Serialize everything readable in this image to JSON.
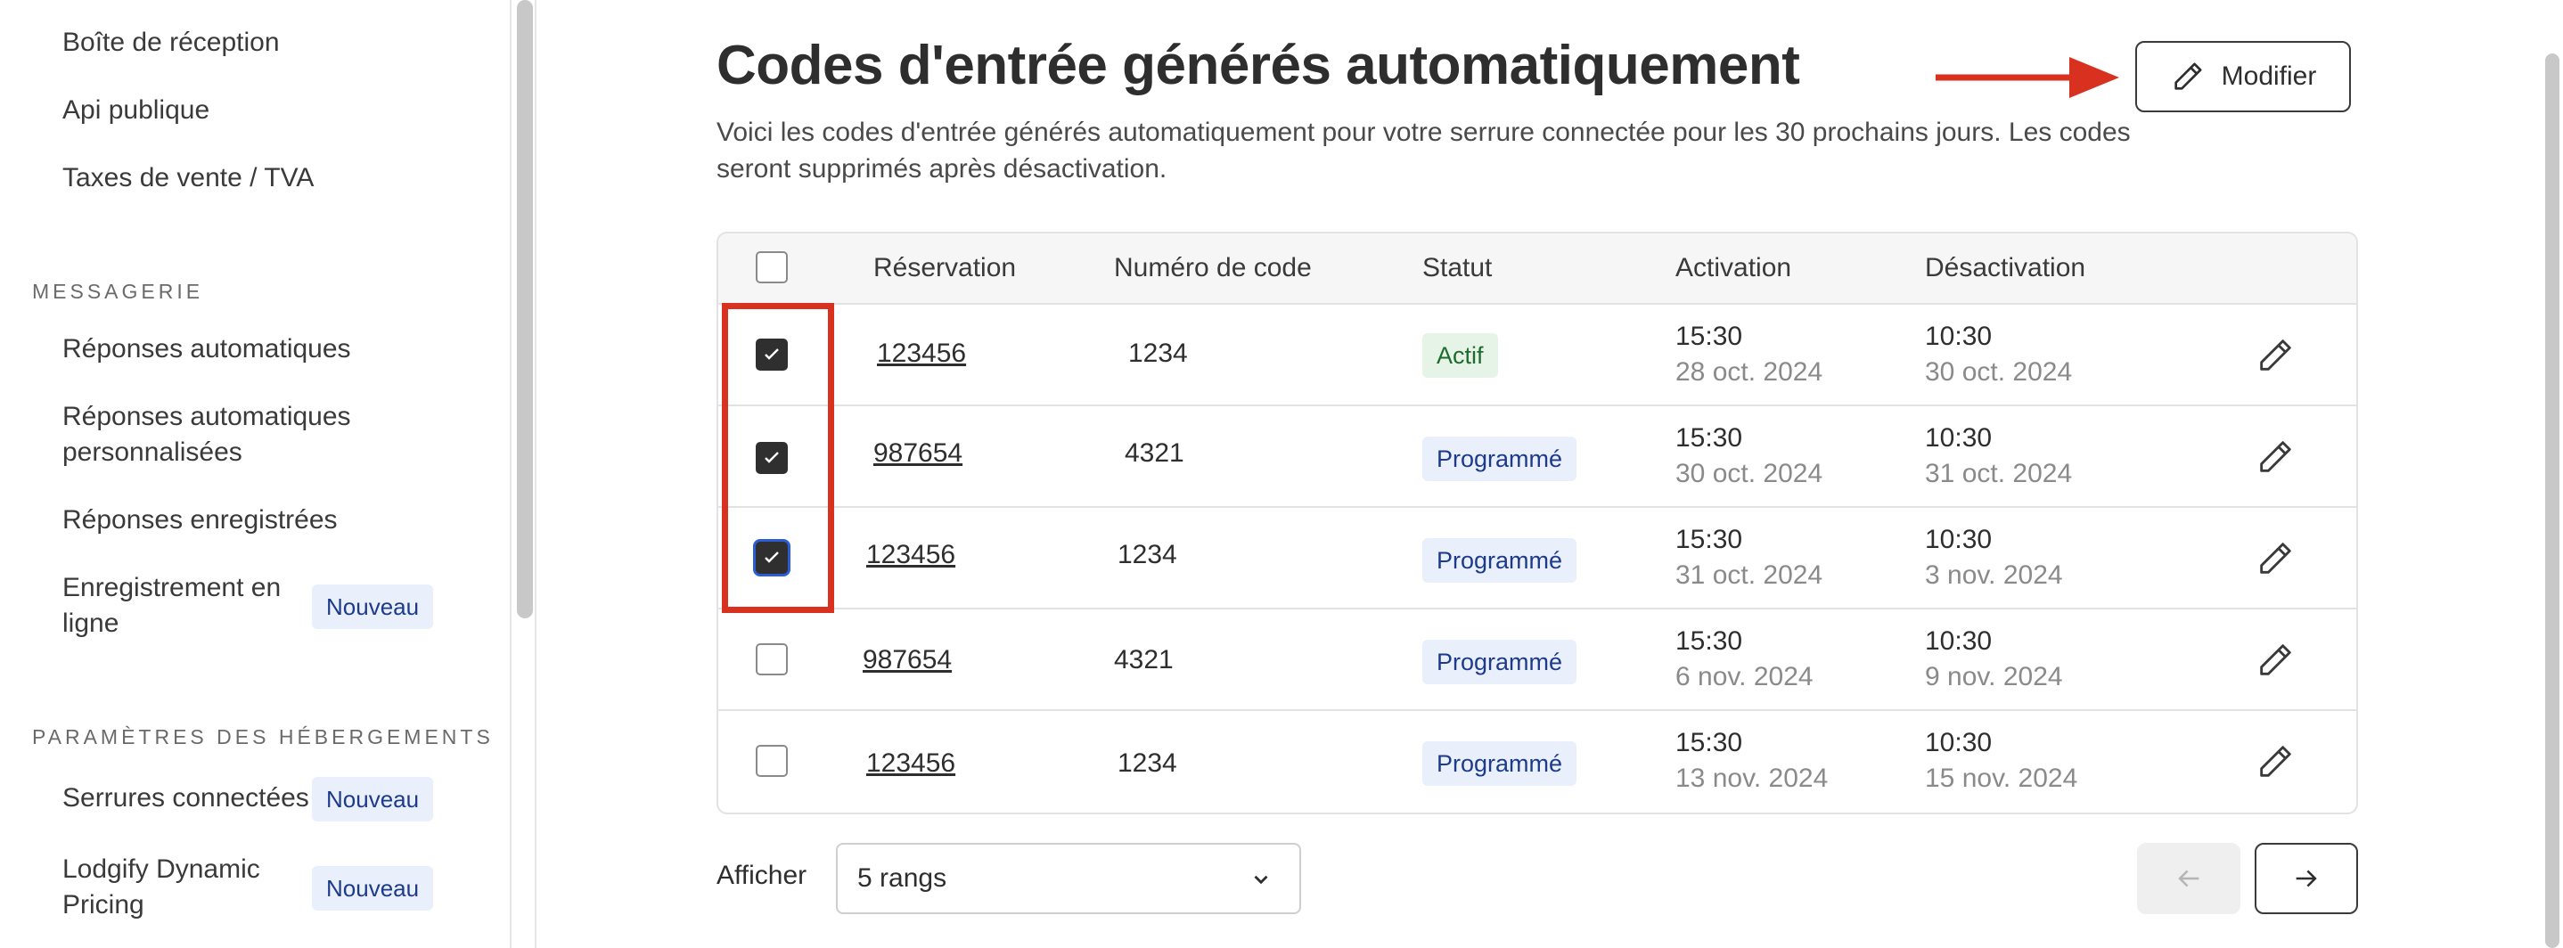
{
  "sidebar": {
    "items_top": [
      "Boîte de réception",
      "Api publique",
      "Taxes de vente / TVA"
    ],
    "messaging": {
      "section": "MESSAGERIE",
      "items": [
        {
          "label": "Réponses automatiques"
        },
        {
          "label_line1": "Réponses automatiques",
          "label_line2": "personnalisées"
        },
        {
          "label": "Réponses enregistrées"
        },
        {
          "label_line1": "Enregistrement en",
          "label_line2": "ligne",
          "badge": "Nouveau"
        }
      ]
    },
    "properties": {
      "section": "PARAMÈTRES DES HÉBERGEMENTS",
      "items": [
        {
          "label": "Serrures connectées",
          "badge": "Nouveau"
        },
        {
          "label_line1": "Lodgify Dynamic",
          "label_line2": "Pricing",
          "badge": "Nouveau"
        }
      ]
    }
  },
  "main": {
    "title": "Codes d'entrée générés automatiquement",
    "description": "Voici les codes d'entrée générés automatiquement pour votre serrure connectée pour les 30 prochains jours. Les codes seront supprimés après désactivation.",
    "modify_button": "Modifier",
    "table": {
      "headers": [
        "Réservation",
        "Numéro de code",
        "Statut",
        "Activation",
        "Désactivation"
      ],
      "rows": [
        {
          "checked": true,
          "reservation": "123456",
          "code": "1234",
          "status": "Actif",
          "status_type": "actif",
          "act_time": "15:30",
          "act_date": "28 oct. 2024",
          "deact_time": "10:30",
          "deact_date": "30 oct. 2024"
        },
        {
          "checked": true,
          "reservation": "987654",
          "code": "4321",
          "status": "Programmé",
          "status_type": "prog",
          "act_time": "15:30",
          "act_date": "30 oct. 2024",
          "deact_time": "10:30",
          "deact_date": "31 oct. 2024"
        },
        {
          "checked": true,
          "reservation": "123456",
          "code": "1234",
          "status": "Programmé",
          "status_type": "prog",
          "act_time": "15:30",
          "act_date": "31 oct. 2024",
          "deact_time": "10:30",
          "deact_date": "3 nov. 2024"
        },
        {
          "checked": false,
          "reservation": "987654",
          "code": "4321",
          "status": "Programmé",
          "status_type": "prog",
          "act_time": "15:30",
          "act_date": "6 nov. 2024",
          "deact_time": "10:30",
          "deact_date": "9 nov. 2024"
        },
        {
          "checked": false,
          "reservation": "123456",
          "code": "1234",
          "status": "Programmé",
          "status_type": "prog",
          "act_time": "15:30",
          "act_date": "13 nov. 2024",
          "deact_time": "10:30",
          "deact_date": "15 nov. 2024"
        }
      ]
    },
    "footer": {
      "show_label": "Afficher",
      "rows_select_value": "5 rangs"
    }
  },
  "colors": {
    "accent_red": "#d9311f",
    "badge_blue_bg": "#e9f0fb",
    "badge_green_bg": "#e6f4e8"
  },
  "icons": [
    "pencil-icon",
    "arrow-right-icon",
    "arrow-left-icon",
    "chevron-down-icon",
    "check-icon"
  ]
}
